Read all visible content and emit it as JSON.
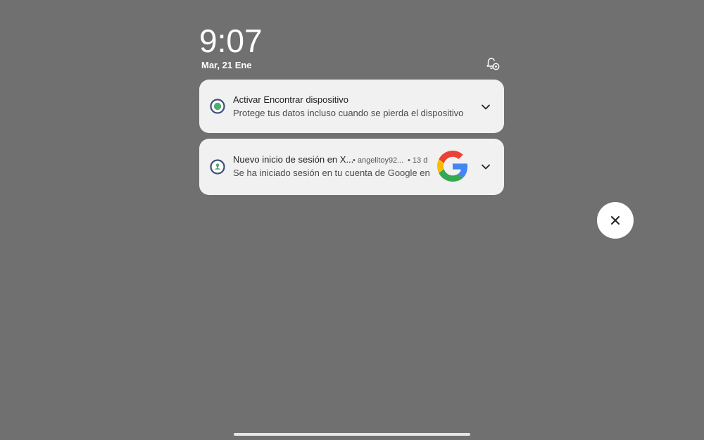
{
  "lockscreen": {
    "time": "9:07",
    "date": "Mar, 21 Ene"
  },
  "notifications": [
    {
      "title": "Activar Encontrar dispositivo",
      "body": "Protege tus datos incluso cuando se pierda el dispositivo",
      "icon": "find-device-icon"
    },
    {
      "title": "Nuevo inicio de sesión en X...",
      "account": "• angelitoy92...",
      "time": "• 13 d",
      "body": "Se ha iniciado sesión en tu cuenta de Google en",
      "icon": "google-account-icon",
      "large_icon": "google-logo-icon"
    }
  ],
  "colors": {
    "background": "#707070",
    "card": "#f1f1f1",
    "google_blue": "#4285F4",
    "google_red": "#EA4335",
    "google_yellow": "#FBBC05",
    "google_green": "#34A853"
  }
}
